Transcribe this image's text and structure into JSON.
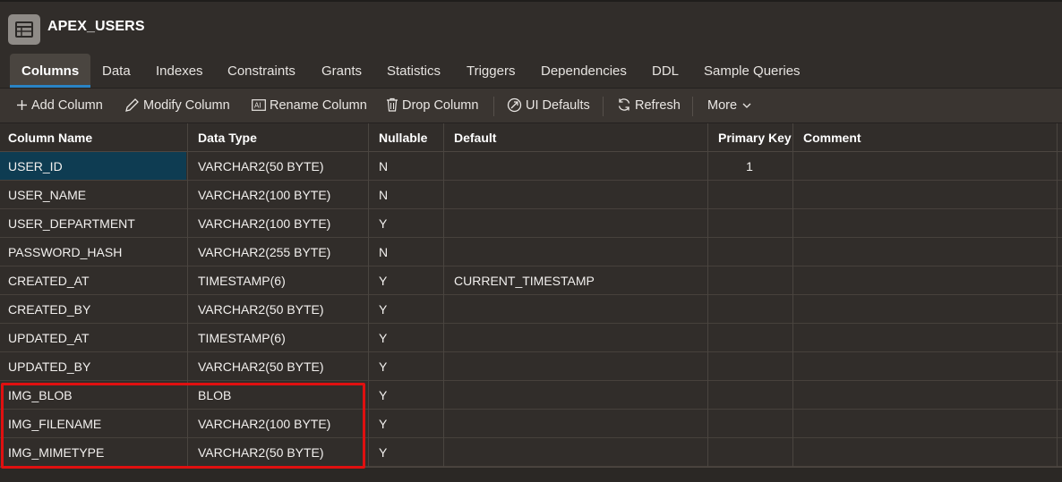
{
  "header": {
    "title": "APEX_USERS",
    "icon": "table-icon"
  },
  "tabs": [
    {
      "label": "Columns",
      "active": true
    },
    {
      "label": "Data"
    },
    {
      "label": "Indexes"
    },
    {
      "label": "Constraints"
    },
    {
      "label": "Grants"
    },
    {
      "label": "Statistics"
    },
    {
      "label": "Triggers"
    },
    {
      "label": "Dependencies"
    },
    {
      "label": "DDL"
    },
    {
      "label": "Sample Queries"
    }
  ],
  "toolbar": {
    "add_column": "Add Column",
    "modify_column": "Modify Column",
    "rename_column": "Rename Column",
    "drop_column": "Drop Column",
    "ui_defaults": "UI Defaults",
    "refresh": "Refresh",
    "more": "More"
  },
  "columns_table": {
    "headers": [
      "Column Name",
      "Data Type",
      "Nullable",
      "Default",
      "Primary Key",
      "Comment"
    ],
    "rows": [
      [
        "USER_ID",
        "VARCHAR2(50 BYTE)",
        "N",
        "",
        "1",
        ""
      ],
      [
        "USER_NAME",
        "VARCHAR2(100 BYTE)",
        "N",
        "",
        "",
        ""
      ],
      [
        "USER_DEPARTMENT",
        "VARCHAR2(100 BYTE)",
        "Y",
        "",
        "",
        ""
      ],
      [
        "PASSWORD_HASH",
        "VARCHAR2(255 BYTE)",
        "N",
        "",
        "",
        ""
      ],
      [
        "CREATED_AT",
        "TIMESTAMP(6)",
        "Y",
        "CURRENT_TIMESTAMP",
        "",
        ""
      ],
      [
        "CREATED_BY",
        "VARCHAR2(50 BYTE)",
        "Y",
        "",
        "",
        ""
      ],
      [
        "UPDATED_AT",
        "TIMESTAMP(6)",
        "Y",
        "",
        "",
        ""
      ],
      [
        "UPDATED_BY",
        "VARCHAR2(50 BYTE)",
        "Y",
        "",
        "",
        ""
      ],
      [
        "IMG_BLOB",
        "BLOB",
        "Y",
        "",
        "",
        ""
      ],
      [
        "IMG_FILENAME",
        "VARCHAR2(100 BYTE)",
        "Y",
        "",
        "",
        ""
      ],
      [
        "IMG_MIMETYPE",
        "VARCHAR2(50 BYTE)",
        "Y",
        "",
        "",
        ""
      ]
    ],
    "selected_row": 0,
    "highlighted_rows": [
      8,
      9,
      10
    ]
  },
  "colors": {
    "background": "#312d2a",
    "selected_cell": "#0e3c52",
    "active_tab_underline": "#2a84c5",
    "highlight_border": "#e01010"
  }
}
